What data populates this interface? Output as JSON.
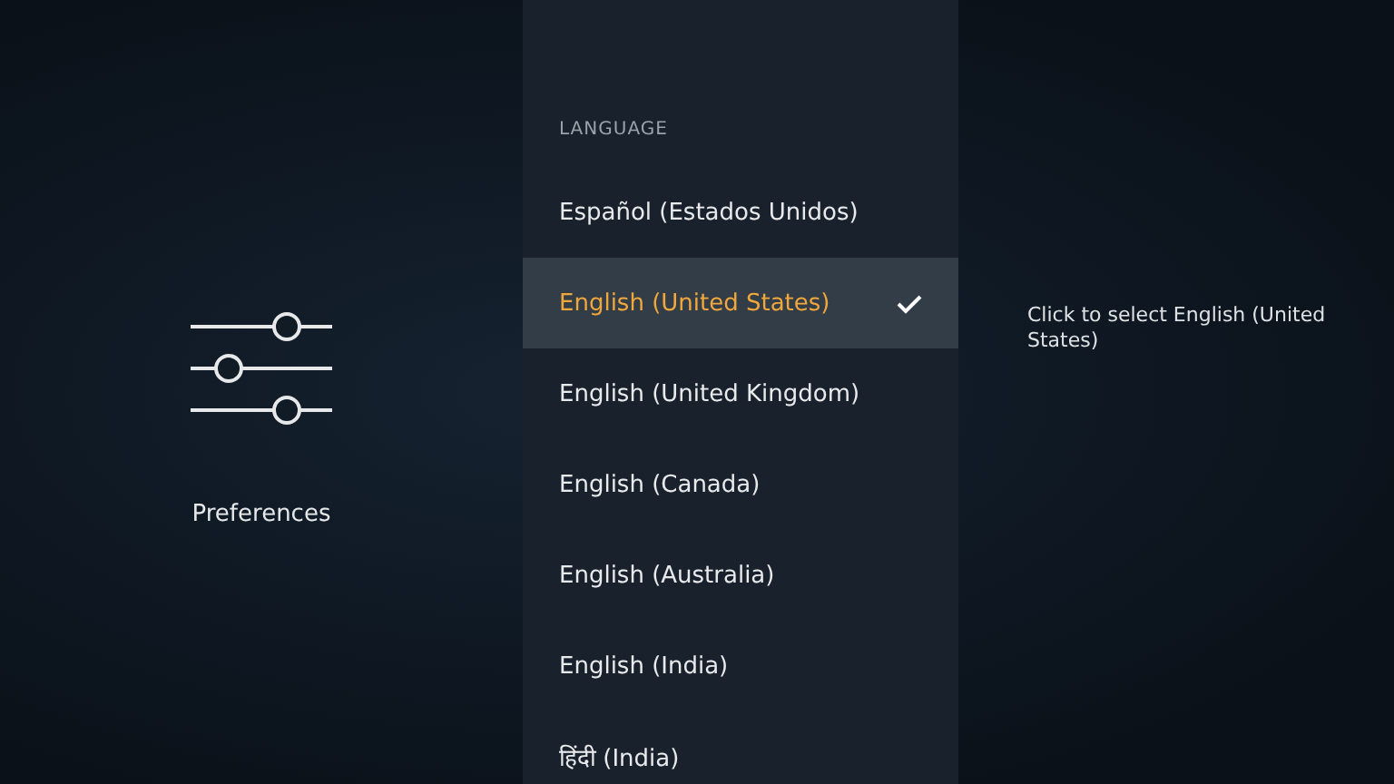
{
  "category": {
    "label": "Preferences"
  },
  "language_list": {
    "heading": "LANGUAGE",
    "items": [
      {
        "label": "Español (Estados Unidos)",
        "selected": false
      },
      {
        "label": "English (United States)",
        "selected": true
      },
      {
        "label": "English (United Kingdom)",
        "selected": false
      },
      {
        "label": "English (Canada)",
        "selected": false
      },
      {
        "label": "English (Australia)",
        "selected": false
      },
      {
        "label": "English (India)",
        "selected": false
      },
      {
        "label": "हिंदी (India)",
        "selected": false
      }
    ]
  },
  "hint": "Click to select English (United States)"
}
